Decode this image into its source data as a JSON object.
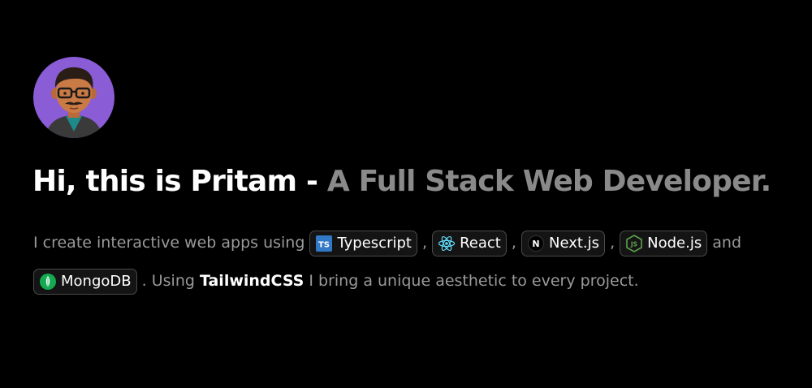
{
  "hero": {
    "headline_name": "Hi, this is Pritam - ",
    "headline_role": "A Full Stack Web Developer."
  },
  "intro": {
    "prefix": "I create interactive web apps using ",
    "sep": " , ",
    "and": " and",
    "using": " . Using ",
    "highlight": "TailwindCSS",
    "suffix": " I bring a unique aesthetic to every project."
  },
  "tech": [
    {
      "label": "Typescript",
      "icon": "typescript-icon",
      "color": "#3178c6"
    },
    {
      "label": "React",
      "icon": "react-icon",
      "color": "#61dafb"
    },
    {
      "label": "Next.js",
      "icon": "nextjs-icon",
      "color": "#ffffff"
    },
    {
      "label": "Node.js",
      "icon": "nodejs-icon",
      "color": "#5fa04e"
    },
    {
      "label": "MongoDB",
      "icon": "mongodb-icon",
      "color": "#13aa52"
    }
  ],
  "colors": {
    "background": "#000000",
    "avatar_bg": "#8a5cd6",
    "muted": "#8a8a8a"
  }
}
